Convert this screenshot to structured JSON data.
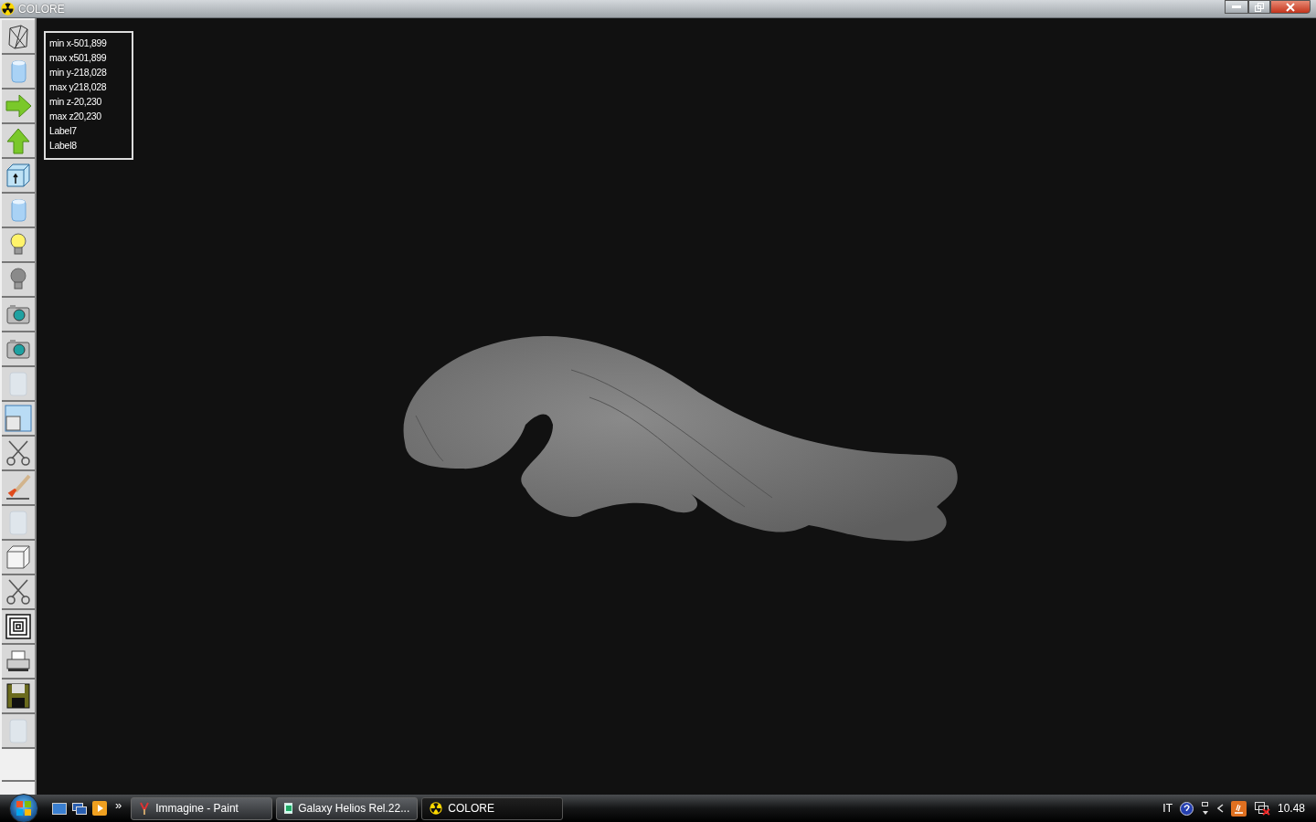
{
  "window": {
    "title": "COLORE"
  },
  "info_labels": [
    "min x-501,899",
    "max x501,899",
    "min y-218,028",
    "max y218,028",
    "min z-20,230",
    "max z20,230",
    "Label7",
    "Label8"
  ],
  "toolbar": [
    {
      "kind": "wireframe"
    },
    {
      "kind": "cylinder"
    },
    {
      "kind": "arrow-right"
    },
    {
      "kind": "arrow-up"
    },
    {
      "kind": "cube-arrow"
    },
    {
      "kind": "cylinder"
    },
    {
      "kind": "bulb-on"
    },
    {
      "kind": "bulb-off"
    },
    {
      "kind": "camera"
    },
    {
      "kind": "camera"
    },
    {
      "kind": "texture"
    },
    {
      "kind": "window"
    },
    {
      "kind": "scissors"
    },
    {
      "kind": "brush"
    },
    {
      "kind": "texture"
    },
    {
      "kind": "cube"
    },
    {
      "kind": "scissors"
    },
    {
      "kind": "squares"
    },
    {
      "kind": "printer"
    },
    {
      "kind": "floppy"
    },
    {
      "kind": "texture"
    },
    {
      "kind": "empty"
    }
  ],
  "taskbar": {
    "overflow": "»",
    "tasks": [
      {
        "label": "Immagine - Paint",
        "kind": "paint",
        "selected": false
      },
      {
        "label": "Galaxy Helios  Rel.22...",
        "kind": "app",
        "selected": false
      },
      {
        "label": "COLORE",
        "kind": "radiation",
        "selected": true
      }
    ],
    "language": "IT",
    "clock": "10.48"
  }
}
